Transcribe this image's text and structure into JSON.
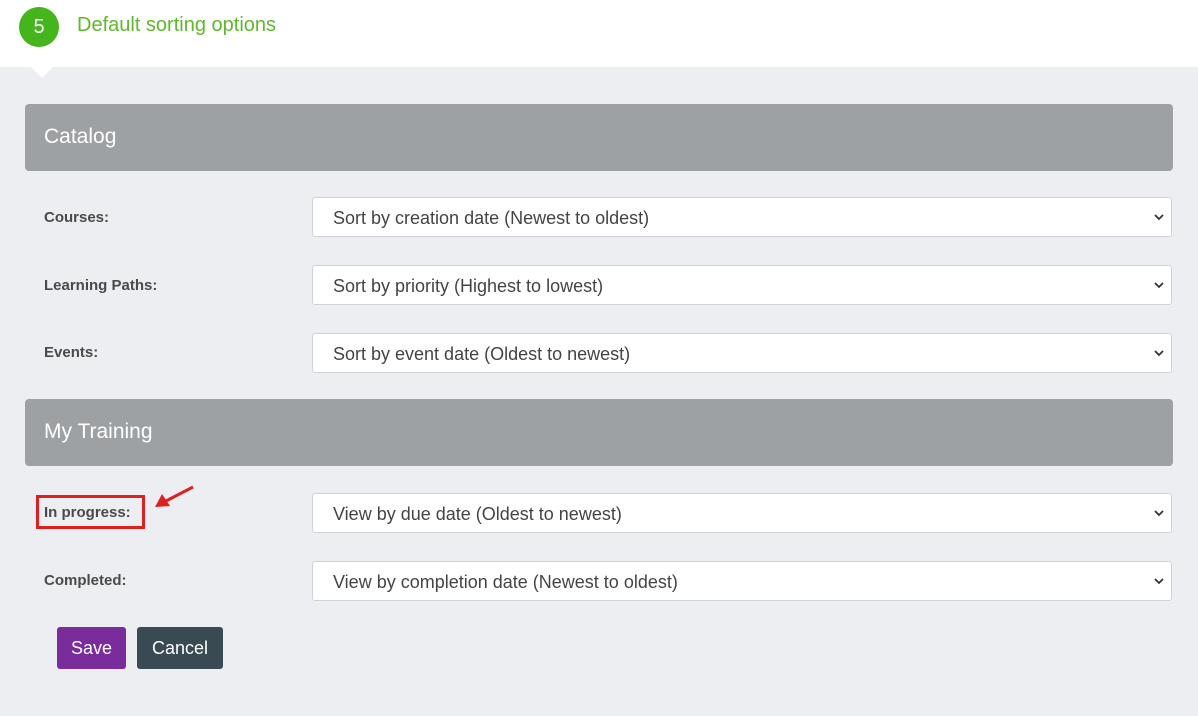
{
  "step": {
    "number": "5",
    "title": "Default sorting options"
  },
  "catalog": {
    "heading": "Catalog",
    "fields": [
      {
        "label": "Courses:",
        "value": "Sort by creation date (Newest to oldest)"
      },
      {
        "label": "Learning Paths:",
        "value": "Sort by priority (Highest to lowest)"
      },
      {
        "label": "Events:",
        "value": "Sort by event date (Oldest to newest)"
      }
    ]
  },
  "my_training": {
    "heading": "My Training",
    "fields": [
      {
        "label": "In progress:",
        "value": "View by due date (Oldest to newest)"
      },
      {
        "label": "Completed:",
        "value": "View by completion date (Newest to oldest)"
      }
    ]
  },
  "buttons": {
    "save": "Save",
    "cancel": "Cancel"
  },
  "colors": {
    "step_accent": "#44b51a",
    "save_button": "#7a2c9c",
    "cancel_button": "#3a4a52",
    "annotation": "#e02020"
  },
  "icons": {
    "dropdown": "chevron-down-icon",
    "annotation": "red-arrow-icon"
  }
}
